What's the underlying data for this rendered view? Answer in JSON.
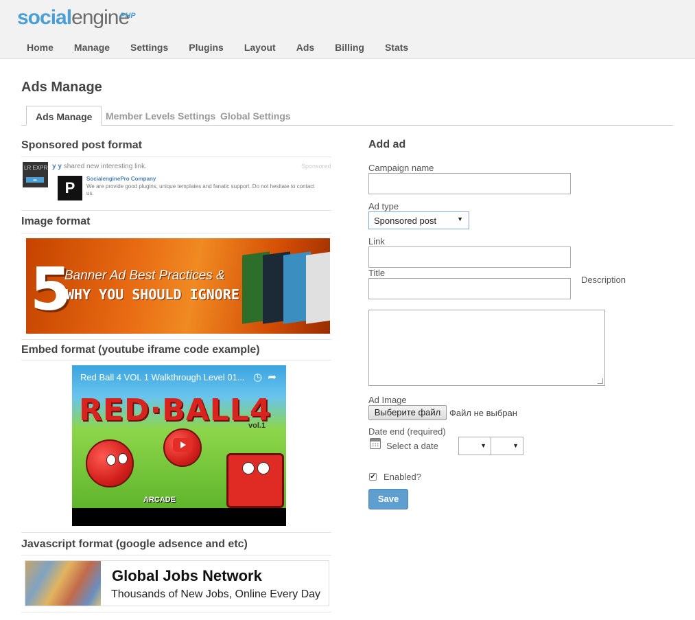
{
  "header": {
    "logo": {
      "part1": "social",
      "part2": "engine",
      "suffix": "PHP"
    },
    "nav": [
      "Home",
      "Manage",
      "Settings",
      "Plugins",
      "Layout",
      "Ads",
      "Billing",
      "Stats"
    ]
  },
  "page": {
    "title": "Ads Manage",
    "tabs": [
      {
        "label": "Ads Manage",
        "active": true
      },
      {
        "label": "Member Levels Settings",
        "active": false
      },
      {
        "label": "Global Settings",
        "active": false
      }
    ]
  },
  "examples": {
    "sponsored": {
      "title": "Sponsored post format",
      "thumb_text": "LR EXPRES",
      "user": "y y",
      "action": "shared new interesting link.",
      "badge": "Sponsored",
      "company": "SocialenginePro Company",
      "description": "We are provide good plugins, unique templates and fanatic support. Do not hesitate to contact us.",
      "logo_letter": "P"
    },
    "image": {
      "title": "Image format",
      "banner_number": "5",
      "banner_line1": "Banner Ad Best Practices &",
      "banner_line2": "WHY YOU SHOULD IGNORE THEM"
    },
    "embed": {
      "title": "Embed format (youtube iframe code example)",
      "video_title": "Red Ball 4 VOL 1 Walkthrough Level 01...",
      "game_logo": "RED·BALL4",
      "game_vol": "vol.1",
      "arcade": "ARCADE"
    },
    "javascript": {
      "title": "Javascript format (google adsence and etc)",
      "headline": "Global Jobs Network",
      "subline": "Thousands of New Jobs, Online Every Day"
    }
  },
  "form": {
    "title": "Add ad",
    "campaign_label": "Campaign name",
    "campaign_value": "",
    "ad_type_label": "Ad type",
    "ad_type_value": "Sponsored post",
    "link_label": "Link",
    "title_label": "Title",
    "description_label": "Description",
    "image_label": "Ad Image",
    "file_button": "Выберите файл",
    "file_status": "Файл не выбран",
    "date_label": "Date end (required)",
    "date_placeholder": "Select a date",
    "enabled_label": "Enabled?",
    "enabled_checked": true,
    "save_label": "Save"
  },
  "colors": {
    "accent": "#4a9fd4",
    "button": "#5f9fd0"
  }
}
